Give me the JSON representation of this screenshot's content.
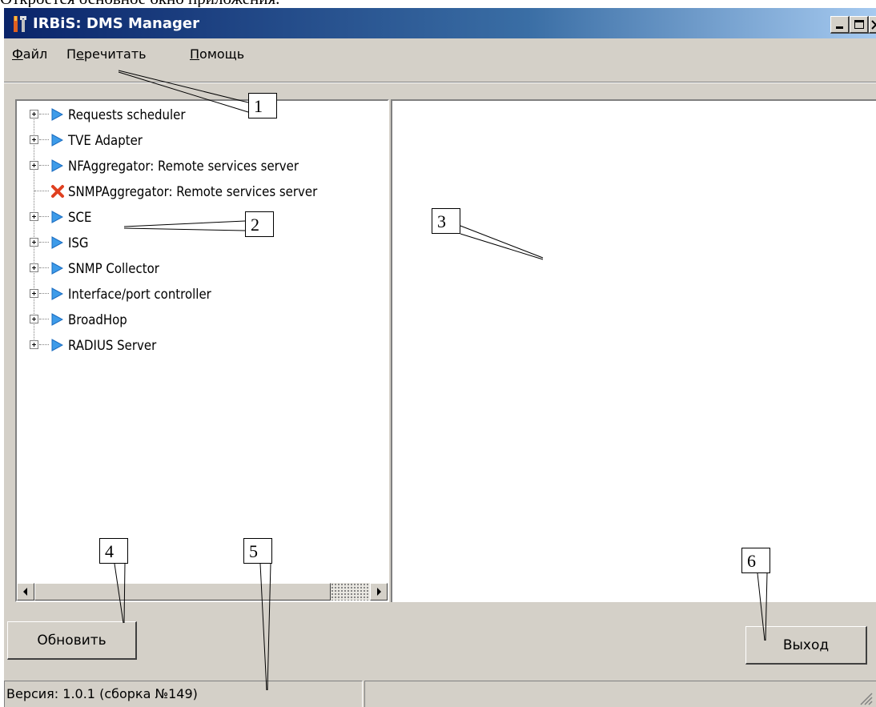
{
  "document_text": "Откроется основное окно приложения.",
  "window": {
    "title": "IRBiS: DMS Manager"
  },
  "menu": {
    "file": {
      "accel": "Ф",
      "rest": "айл"
    },
    "reread": {
      "pre": "П",
      "accel": "е",
      "rest": "речитать"
    },
    "help": {
      "accel": "П",
      "rest": "омощь"
    }
  },
  "tree": {
    "items": [
      {
        "label": "Requests scheduler",
        "icon": "play-icon",
        "expandable": true
      },
      {
        "label": "TVE Adapter",
        "icon": "play-icon",
        "expandable": true
      },
      {
        "label": "NFAggregator: Remote services server",
        "icon": "play-icon",
        "expandable": true
      },
      {
        "label": "SNMPAggregator: Remote services server",
        "icon": "error-icon",
        "expandable": false
      },
      {
        "label": "SCE",
        "icon": "play-icon",
        "expandable": true
      },
      {
        "label": "ISG",
        "icon": "play-icon",
        "expandable": true
      },
      {
        "label": "SNMP Collector",
        "icon": "play-icon",
        "expandable": true
      },
      {
        "label": "Interface/port controller",
        "icon": "play-icon",
        "expandable": true
      },
      {
        "label": "BroadHop",
        "icon": "play-icon",
        "expandable": true
      },
      {
        "label": "RADIUS Server",
        "icon": "play-icon",
        "expandable": true
      }
    ]
  },
  "buttons": {
    "refresh": "Обновить",
    "exit": "Выход"
  },
  "status": {
    "version": "Версия: 1.0.1 (сборка №149)"
  },
  "callouts": [
    "1",
    "2",
    "3",
    "4",
    "5",
    "6"
  ],
  "colors": {
    "titlebar_start": "#0a246a",
    "titlebar_end": "#a6caf0",
    "face": "#d4d0c8",
    "play_icon": "#3d9be9",
    "error_icon": "#e04020"
  }
}
